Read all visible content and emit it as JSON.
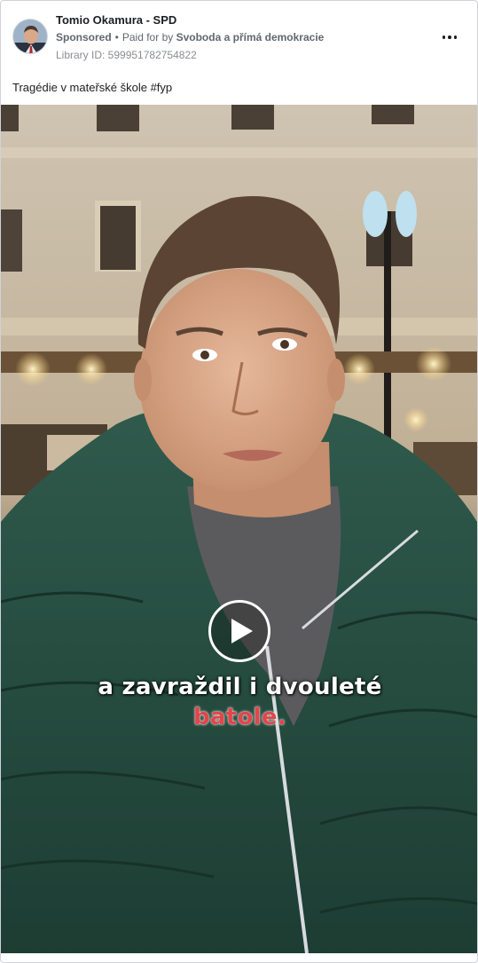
{
  "post": {
    "page_name": "Tomio Okamura - SPD",
    "sponsored": "Sponsored",
    "paid_for_prefix": "Paid for by",
    "paid_for_by": "Svoboda a přímá demokracie",
    "library_id": "Library ID: 599951782754822",
    "caption": "Tragédie v mateřské škole #fyp",
    "more_icon": "more-options-icon"
  },
  "video": {
    "subtitle_line1": "a zavraždil i dvouleté",
    "subtitle_line2": "batole.",
    "subtitle_colors": {
      "line1": "#ffffff",
      "line2": "#e0464a"
    },
    "play_icon": "play-icon"
  }
}
